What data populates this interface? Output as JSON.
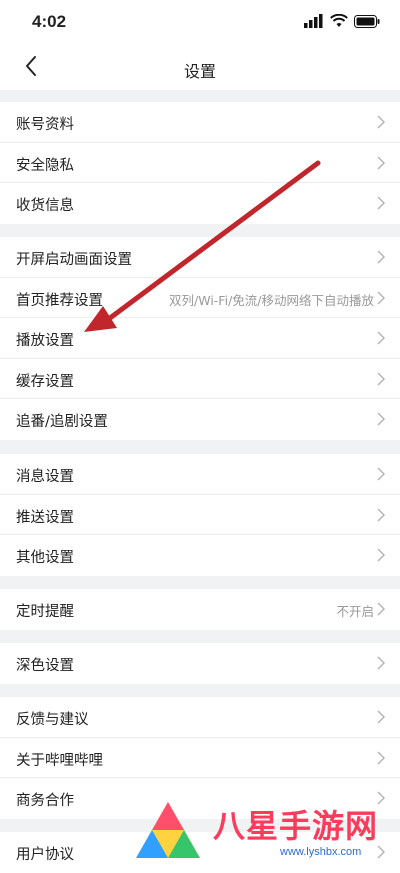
{
  "status_bar": {
    "time": "4:02"
  },
  "header": {
    "title": "设置"
  },
  "sections": [
    {
      "items": [
        {
          "label": "账号资料"
        },
        {
          "label": "安全隐私"
        },
        {
          "label": "收货信息"
        }
      ]
    },
    {
      "items": [
        {
          "label": "开屏启动画面设置"
        },
        {
          "label": "首页推荐设置",
          "value": "双列/Wi-Fi/免流/移动网络下自动播放"
        },
        {
          "label": "播放设置"
        },
        {
          "label": "缓存设置"
        },
        {
          "label": "追番/追剧设置"
        }
      ]
    },
    {
      "items": [
        {
          "label": "消息设置"
        },
        {
          "label": "推送设置"
        },
        {
          "label": "其他设置"
        }
      ]
    },
    {
      "items": [
        {
          "label": "定时提醒",
          "value": "不开启"
        }
      ]
    },
    {
      "items": [
        {
          "label": "深色设置"
        }
      ]
    },
    {
      "items": [
        {
          "label": "反馈与建议"
        },
        {
          "label": "关于哔哩哔哩"
        },
        {
          "label": "商务合作"
        }
      ]
    },
    {
      "items": [
        {
          "label": "用户协议"
        }
      ]
    }
  ],
  "watermark": {
    "text": "八星手游网",
    "url": "www.lyshbx.com"
  },
  "colors": {
    "arrow": "#c0262b",
    "watermark_text": "#ff3b5c",
    "chevron": "#b5b5b5"
  }
}
